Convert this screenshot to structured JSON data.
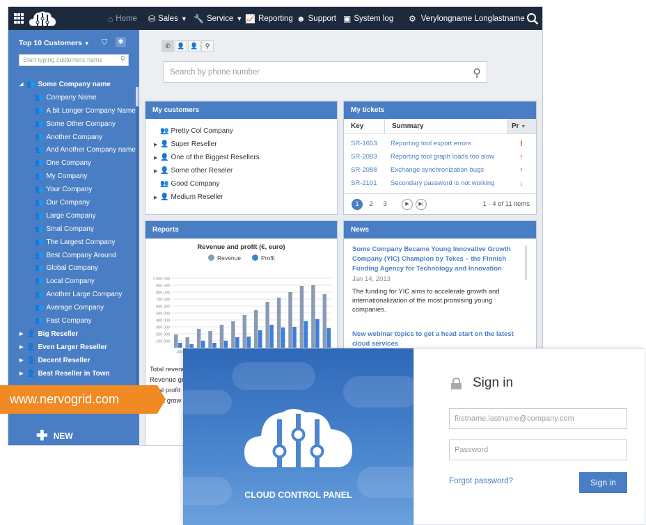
{
  "topbar": {
    "home": "Home",
    "sales": "Sales",
    "service": "Service",
    "reporting": "Reporting",
    "support": "Support",
    "system_log": "System log",
    "user": "Verylongname Longlastname"
  },
  "sidebar": {
    "heading": "Top 10 Customers",
    "search_placeholder": "Start typing customers name",
    "root": "Some Company name",
    "children": [
      "Company Name",
      "A bit Longer Company Name",
      "Some Other Company",
      "Another Company",
      "And Another Company name",
      "One Company",
      "My Company",
      "Your Company",
      "Our Company",
      "Large Company",
      "Smal Company",
      "The Largest Company",
      "Best Company Around",
      "Global Company",
      "Local Company",
      "Another Large Company",
      "Average Company",
      "Fast Company"
    ],
    "resellers": [
      "Big Reseller",
      "Even Larger Reseller",
      "Decent Reseller",
      "Best Reseller in Town"
    ],
    "new_label": "NEW"
  },
  "search": {
    "placeholder": "Search by phone number"
  },
  "my_customers": {
    "title": "My customers",
    "items": [
      {
        "name": "Pretty Col Company",
        "expandable": false
      },
      {
        "name": "Super Reseller",
        "expandable": true
      },
      {
        "name": "One of the Biggest Resellers",
        "expandable": true
      },
      {
        "name": "Some other Reseler",
        "expandable": true
      },
      {
        "name": "Good Company",
        "expandable": false
      },
      {
        "name": "Medium Reseller",
        "expandable": true
      }
    ]
  },
  "my_tickets": {
    "title": "My tickets",
    "headers": [
      "Key",
      "Summary",
      "Pr"
    ],
    "rows": [
      {
        "key": "SR-1653",
        "summary": "Reporting tool export errors",
        "priority": "!",
        "color": "#d9342b"
      },
      {
        "key": "SR-2083",
        "summary": "Reporting tool graph loads too slow",
        "priority": "↑",
        "color": "#d9342b"
      },
      {
        "key": "SR-2088",
        "summary": "Exchange synchronization bugs",
        "priority": "↑",
        "color": "#d9342b"
      },
      {
        "key": "SR-2101",
        "summary": "Secondary password is not working",
        "priority": "↓",
        "color": "#5aa63c"
      }
    ],
    "pages": [
      "1",
      "2",
      "3"
    ],
    "range": "1 - 4 of 11 items"
  },
  "reports": {
    "title": "Reports",
    "totals": [
      "Total revenue",
      "Revenue gr",
      "Total profit",
      "Profit grow"
    ]
  },
  "chart_data": {
    "type": "bar",
    "title": "Revenue and profit (€, euro)",
    "ylim": [
      0,
      1000000
    ],
    "yticks": [
      "1 000 000",
      "900 000",
      "800 000",
      "700 000",
      "600 000",
      "500 000",
      "400 000",
      "300 000",
      "200 000",
      "100 000"
    ],
    "xlabel_first": "JAN",
    "series": [
      {
        "name": "Revenue",
        "color": "#8a9bb5",
        "values": [
          190000,
          150000,
          270000,
          240000,
          330000,
          380000,
          470000,
          540000,
          660000,
          720000,
          800000,
          890000,
          900000,
          770000
        ]
      },
      {
        "name": "Profit",
        "color": "#3e7fd9",
        "values": [
          70000,
          50000,
          100000,
          70000,
          100000,
          150000,
          160000,
          250000,
          330000,
          290000,
          300000,
          380000,
          410000,
          280000
        ]
      }
    ]
  },
  "news": {
    "title": "News",
    "headline1": "Some Company Became Young Innovative Growth Company (YIC) Champion by Tekes – the Finnish Funding Agency for Technology and Innovation",
    "date1": "Jan 14, 2013",
    "body1": "The funding for YIC aims to accelerate growth and internationalization of the most promising young companies.",
    "headline2": "New webinar topics to get a head start on the latest cloud services"
  },
  "login": {
    "product": "CLOUD CONTROL PANEL",
    "title": "Sign in",
    "email_placeholder": "firstname.lastname@company.com",
    "password_placeholder": "Password",
    "forgot": "Forgot password?",
    "button": "Sign in"
  },
  "banner": {
    "url": "www.nervogrid.com",
    "color": "#f08a24"
  }
}
